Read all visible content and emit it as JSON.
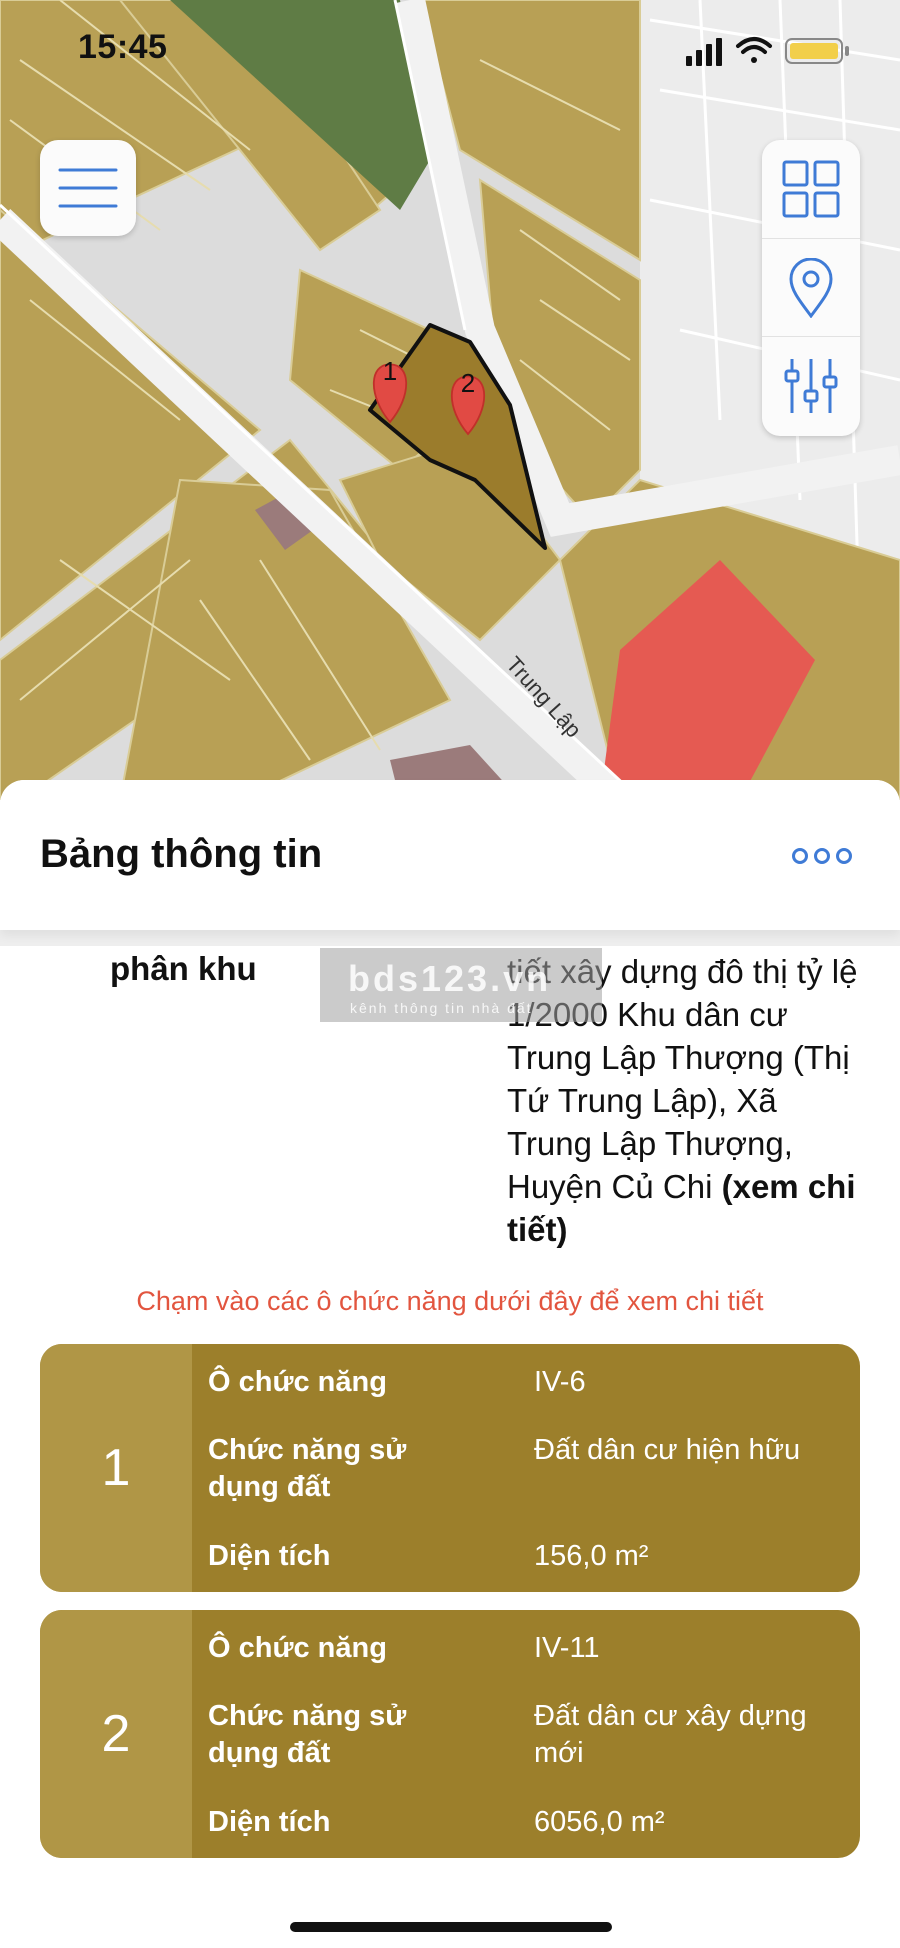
{
  "status_bar": {
    "time": "15:45"
  },
  "map": {
    "street_label": "Trung Lập",
    "markers": [
      "1",
      "2"
    ],
    "colors": {
      "residential": "#b8a055",
      "selected": "#9b7c2c",
      "park": "#5f7c45",
      "commercial": "#e55a52",
      "road": "#dcdcdc"
    }
  },
  "controls": {
    "menu_icon": "hamburger-icon",
    "tools": [
      "grid-icon",
      "location-pin-icon",
      "sliders-icon"
    ]
  },
  "sheet": {
    "title": "Bảng thông tin",
    "more_icon": "more-dots-icon",
    "watermark": {
      "main": "bds123.vn",
      "sub": "kênh thông tin nhà đất"
    },
    "info_row": {
      "label": "phân khu",
      "value_text": "tiết xây dựng đô thị tỷ lệ 1/2000 Khu dân cư Trung Lập Thượng (Thị Tứ Trung Lập), Xã Trung Lập Thượng, Huyện Củ Chi ",
      "detail_link": "(xem chi tiết)"
    },
    "hint": "Chạm vào các ô chức năng dưới đây để xem chi tiết",
    "plots": [
      {
        "number": "1",
        "rows": [
          {
            "label": "Ô chức năng",
            "value": "IV-6"
          },
          {
            "label": "Chức năng sử dụng đất",
            "value": "Đất dân cư hiện hữu"
          },
          {
            "label": "Diện tích",
            "value": "156,0 m²"
          }
        ]
      },
      {
        "number": "2",
        "rows": [
          {
            "label": "Ô chức năng",
            "value": "IV-11"
          },
          {
            "label": "Chức năng sử dụng đất",
            "value": "Đất dân cư xây dựng mới"
          },
          {
            "label": "Diện tích",
            "value": "6056,0 m²"
          }
        ]
      }
    ]
  }
}
